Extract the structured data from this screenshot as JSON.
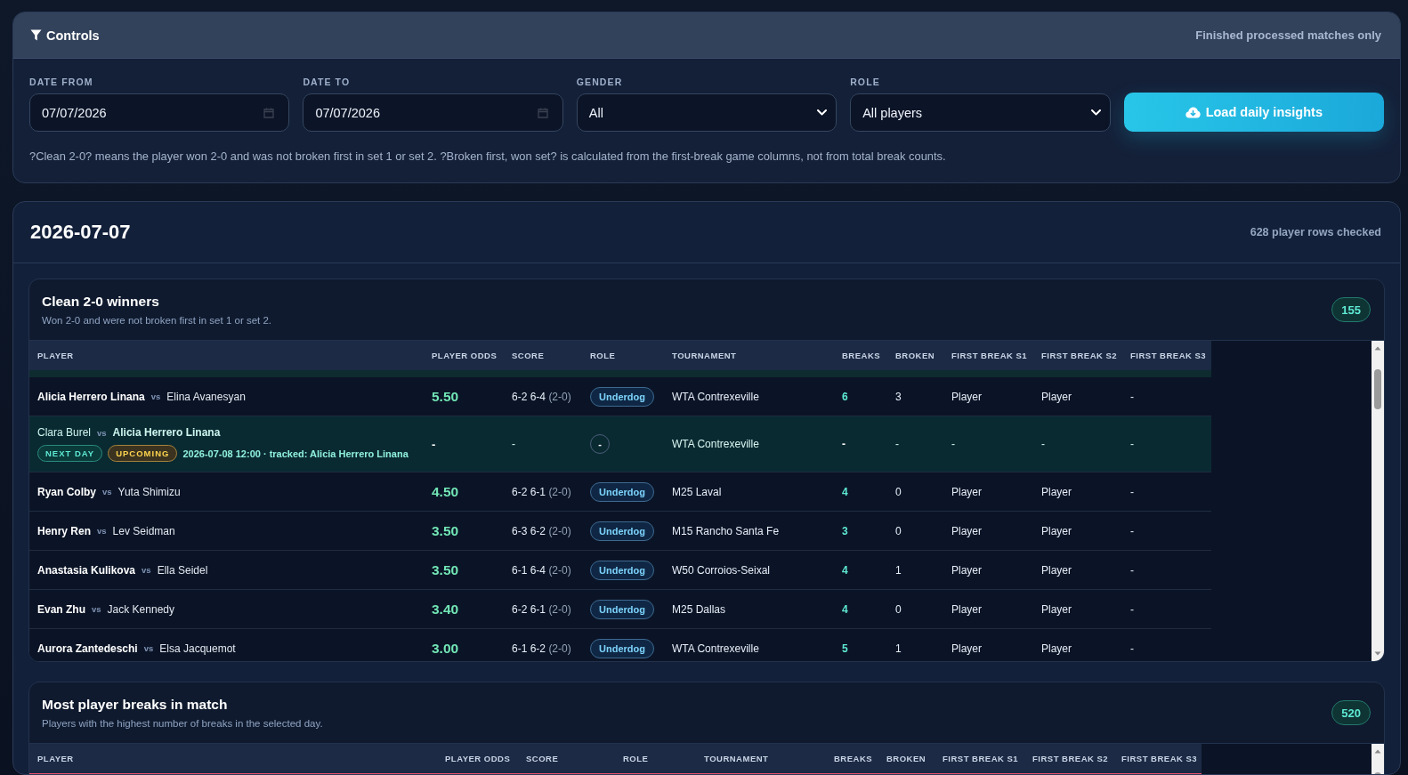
{
  "controls": {
    "title": "Controls",
    "scope_note": "Finished processed matches only",
    "fields": [
      {
        "kind": "date",
        "label": "DATE FROM",
        "value": "07/07/2026"
      },
      {
        "kind": "date",
        "label": "DATE TO",
        "value": "07/07/2026"
      },
      {
        "kind": "select",
        "label": "GENDER",
        "value": "All"
      },
      {
        "kind": "select",
        "label": "ROLE",
        "value": "All players"
      }
    ],
    "button": "Load daily insights",
    "hint": "?Clean 2-0? means the player won 2-0 and was not broken first in set 1 or set 2. ?Broken first, won set? is calculated from the first-break game columns, not from total break counts."
  },
  "day": {
    "date": "2026-07-07",
    "summary": "628 player rows checked",
    "sections": [
      {
        "kind": "clean",
        "title": "Clean 2-0 winners",
        "subtitle": "Won 2-0 and were not broken first in set 1 or set 2.",
        "count": "155",
        "columns": [
          "PLAYER",
          "PLAYER ODDS",
          "SCORE",
          "ROLE",
          "TOURNAMENT",
          "BREAKS",
          "BROKEN",
          "FIRST BREAK S1",
          "FIRST BREAK S2",
          "FIRST BREAK S3"
        ],
        "rows": [
          {
            "kind": "result",
            "players": [
              {
                "name": "Alicia Herrero Linana",
                "tracked": true
              },
              {
                "name": "Elina Avanesyan",
                "tracked": false
              }
            ],
            "vs": "vs",
            "odds": "5.50",
            "score": "6-2 6-4",
            "sets": "(2-0)",
            "role": "Underdog",
            "tournament": "WTA Contrexeville",
            "breaks": "6",
            "broken": "3",
            "first_break_s1": "Player",
            "first_break_s2": "Player",
            "first_break_s3": "-"
          },
          {
            "kind": "upcoming",
            "players": [
              {
                "name": "Clara Burel",
                "tracked": false
              },
              {
                "name": "Alicia Herrero Linana",
                "tracked": true
              }
            ],
            "vs": "vs",
            "tags": [
              {
                "kind": "next_day",
                "label": "NEXT DAY"
              },
              {
                "kind": "upcoming",
                "label": "UPCOMING"
              }
            ],
            "detail": "2026-07-08 12:00 · tracked: Alicia Herrero Linana",
            "odds": "-",
            "score": "-",
            "role": "-",
            "tournament": "WTA Contrexeville",
            "breaks": "-",
            "broken": "-",
            "first_break_s1": "-",
            "first_break_s2": "-",
            "first_break_s3": "-"
          },
          {
            "kind": "result",
            "players": [
              {
                "name": "Ryan Colby",
                "tracked": true
              },
              {
                "name": "Yuta Shimizu",
                "tracked": false
              }
            ],
            "vs": "vs",
            "odds": "4.50",
            "score": "6-2 6-1",
            "sets": "(2-0)",
            "role": "Underdog",
            "tournament": "M25 Laval",
            "breaks": "4",
            "broken": "0",
            "first_break_s1": "Player",
            "first_break_s2": "Player",
            "first_break_s3": "-"
          },
          {
            "kind": "result",
            "players": [
              {
                "name": "Henry Ren",
                "tracked": true
              },
              {
                "name": "Lev Seidman",
                "tracked": false
              }
            ],
            "vs": "vs",
            "odds": "3.50",
            "score": "6-3 6-2",
            "sets": "(2-0)",
            "role": "Underdog",
            "tournament": "M15 Rancho Santa Fe",
            "breaks": "3",
            "broken": "0",
            "first_break_s1": "Player",
            "first_break_s2": "Player",
            "first_break_s3": "-"
          },
          {
            "kind": "result",
            "players": [
              {
                "name": "Anastasia Kulikova",
                "tracked": true
              },
              {
                "name": "Ella Seidel",
                "tracked": false
              }
            ],
            "vs": "vs",
            "odds": "3.50",
            "score": "6-1 6-4",
            "sets": "(2-0)",
            "role": "Underdog",
            "tournament": "W50 Corroios-Seixal",
            "breaks": "4",
            "broken": "1",
            "first_break_s1": "Player",
            "first_break_s2": "Player",
            "first_break_s3": "-"
          },
          {
            "kind": "result",
            "players": [
              {
                "name": "Evan Zhu",
                "tracked": true
              },
              {
                "name": "Jack Kennedy",
                "tracked": false
              }
            ],
            "vs": "vs",
            "odds": "3.40",
            "score": "6-2 6-1",
            "sets": "(2-0)",
            "role": "Underdog",
            "tournament": "M25 Dallas",
            "breaks": "4",
            "broken": "0",
            "first_break_s1": "Player",
            "first_break_s2": "Player",
            "first_break_s3": "-"
          },
          {
            "kind": "result",
            "players": [
              {
                "name": "Aurora Zantedeschi",
                "tracked": true
              },
              {
                "name": "Elsa Jacquemot",
                "tracked": false
              }
            ],
            "vs": "vs",
            "odds": "3.00",
            "score": "6-1 6-2",
            "sets": "(2-0)",
            "role": "Underdog",
            "tournament": "WTA Contrexeville",
            "breaks": "5",
            "broken": "1",
            "first_break_s1": "Player",
            "first_break_s2": "Player",
            "first_break_s3": "-"
          }
        ]
      },
      {
        "kind": "breaks",
        "title": "Most player breaks in match",
        "subtitle": "Players with the highest number of breaks in the selected day.",
        "count": "520",
        "columns": [
          "PLAYER",
          "PLAYER ODDS",
          "SCORE",
          "ROLE",
          "TOURNAMENT",
          "BREAKS",
          "BROKEN",
          "FIRST BREAK S1",
          "FIRST BREAK S2",
          "FIRST BREAK S3"
        ]
      }
    ]
  }
}
